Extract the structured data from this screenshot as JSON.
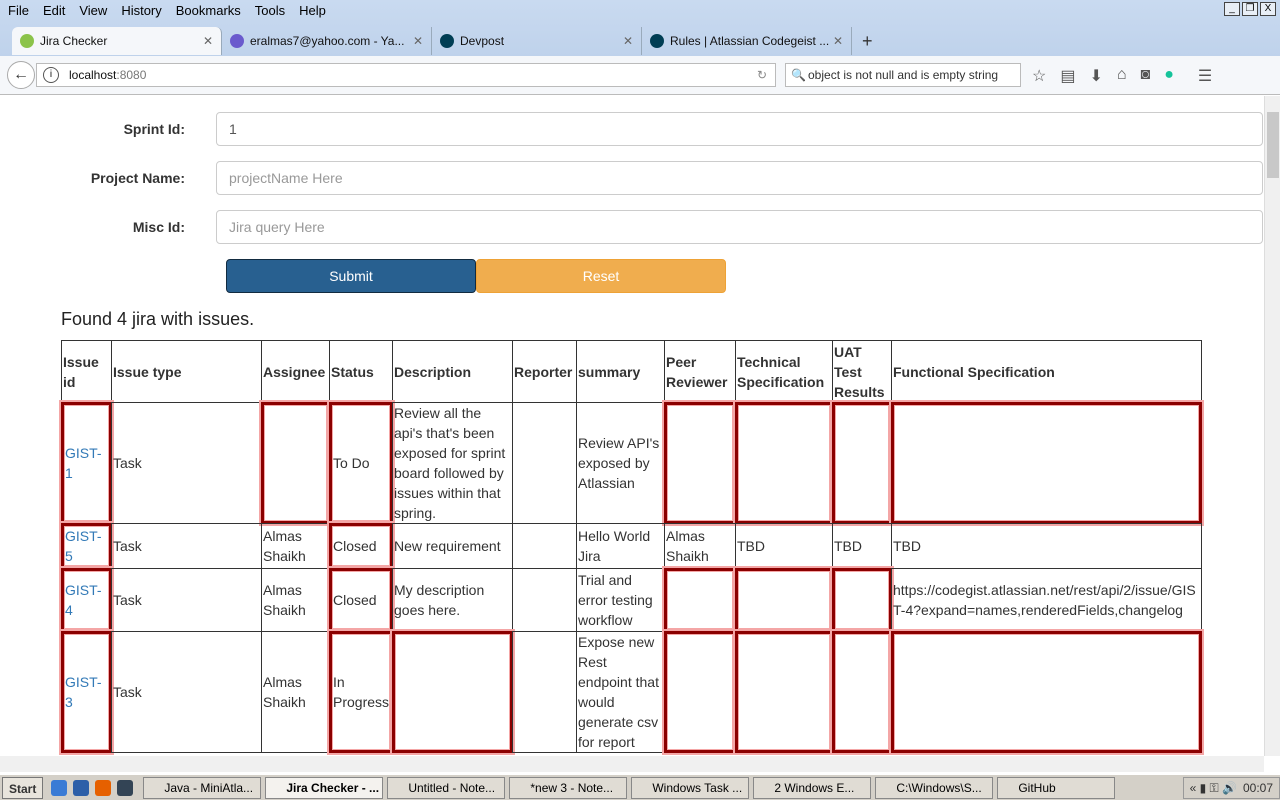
{
  "browser": {
    "menu": [
      "File",
      "Edit",
      "View",
      "History",
      "Bookmarks",
      "Tools",
      "Help"
    ],
    "tabs": [
      {
        "title": "Jira Checker",
        "icon": "spring-leaf-icon",
        "color": "#8bc34a",
        "active": true
      },
      {
        "title": "eralmas7@yahoo.com - Ya...",
        "icon": "mail-icon",
        "color": "#6a5acd"
      },
      {
        "title": "Devpost",
        "icon": "devpost-icon",
        "color": "#003e54"
      },
      {
        "title": "Rules | Atlassian Codegeist ...",
        "icon": "devpost-icon",
        "color": "#003e54"
      }
    ],
    "url_host": "localhost",
    "url_port": ":8080",
    "search_value": "object is not null and is empty string"
  },
  "form": {
    "sprint_label": "Sprint Id:",
    "sprint_value": "1",
    "project_label": "Project Name:",
    "project_placeholder": "projectName Here",
    "misc_label": "Misc Id:",
    "misc_placeholder": "Jira query Here",
    "submit": "Submit",
    "reset": "Reset",
    "submit_color": "#286090",
    "reset_color": "#f0ad4e"
  },
  "result_text": "Found 4 jira with issues.",
  "table": {
    "headers": [
      "Issue id",
      "Issue type",
      "Assignee",
      "Status",
      "Description",
      "Reporter",
      "summary",
      "Peer Reviewer",
      "Technical Specification",
      "UAT Test Results",
      "Functional Specification"
    ],
    "rows": [
      {
        "cells": [
          "GIST-1",
          "Task",
          "",
          "To Do",
          "Review all the api's that's been exposed for sprint board followed by issues within that spring.",
          "",
          "Review API's exposed by Atlassian",
          "",
          "",
          "",
          ""
        ],
        "flagged": [
          0,
          2,
          3,
          7,
          8,
          9,
          10
        ]
      },
      {
        "cells": [
          "GIST-5",
          "Task",
          "Almas Shaikh",
          "Closed",
          "New requirement",
          "",
          "Hello World Jira",
          "Almas Shaikh",
          "TBD",
          "TBD",
          "TBD"
        ],
        "flagged": [
          0,
          3
        ]
      },
      {
        "cells": [
          "GIST-4",
          "Task",
          "Almas Shaikh",
          "Closed",
          "My description goes here.",
          "",
          "Trial and error testing workflow",
          "",
          "",
          "",
          "https://codegist.atlassian.net/rest/api/2/issue/GIST-4?expand=names,renderedFields,changelog"
        ],
        "flagged": [
          0,
          3,
          7,
          8,
          9
        ]
      },
      {
        "cells": [
          "GIST-3",
          "Task",
          "Almas Shaikh",
          "In Progress",
          "",
          "",
          "Expose new Rest endpoint that would generate csv for report",
          "",
          "",
          "",
          ""
        ],
        "flagged": [
          0,
          3,
          4,
          7,
          8,
          9,
          10
        ]
      }
    ]
  },
  "taskbar": {
    "start": "Start",
    "items": [
      "Java - MiniAtla...",
      "Jira Checker - ...",
      "Untitled - Note...",
      "*new  3 - Note...",
      "Windows Task ...",
      "2 Windows E...",
      "C:\\Windows\\S...",
      "GitHub"
    ],
    "active_index": 1,
    "clock": "00:07"
  }
}
